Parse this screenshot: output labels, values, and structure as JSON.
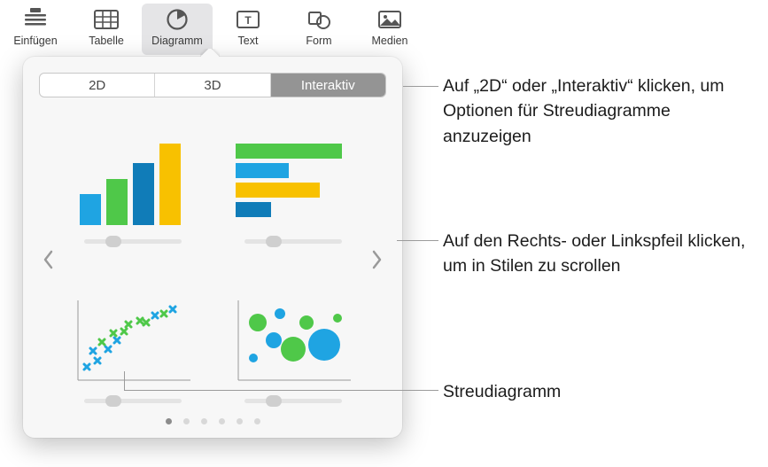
{
  "toolbar": {
    "items": [
      {
        "label": "Einfügen",
        "icon": "insert"
      },
      {
        "label": "Tabelle",
        "icon": "table"
      },
      {
        "label": "Diagramm",
        "icon": "chart",
        "active": true
      },
      {
        "label": "Text",
        "icon": "text"
      },
      {
        "label": "Form",
        "icon": "shape"
      },
      {
        "label": "Medien",
        "icon": "media"
      }
    ]
  },
  "popover": {
    "tabs": {
      "t2d": "2D",
      "t3d": "3D",
      "interactive": "Interaktiv",
      "selected": "interactive"
    },
    "charts": [
      {
        "name": "column-chart"
      },
      {
        "name": "bar-chart"
      },
      {
        "name": "scatter-chart"
      },
      {
        "name": "bubble-chart"
      }
    ],
    "page_count": 6,
    "active_page": 0
  },
  "annotations": {
    "tabs_hint": "Auf „2D“ oder „Interaktiv“ klicken, um Optionen für Streudiagramme anzuzeigen",
    "arrows_hint": "Auf den Rechts- oder Linkspfeil klicken, um in Stilen zu scrollen",
    "scatter_hint": "Streudiagramm"
  },
  "colors": {
    "blue": "#1fa4e2",
    "green": "#4fc849",
    "yellow": "#f8c100",
    "darkblue": "#107cb8"
  }
}
